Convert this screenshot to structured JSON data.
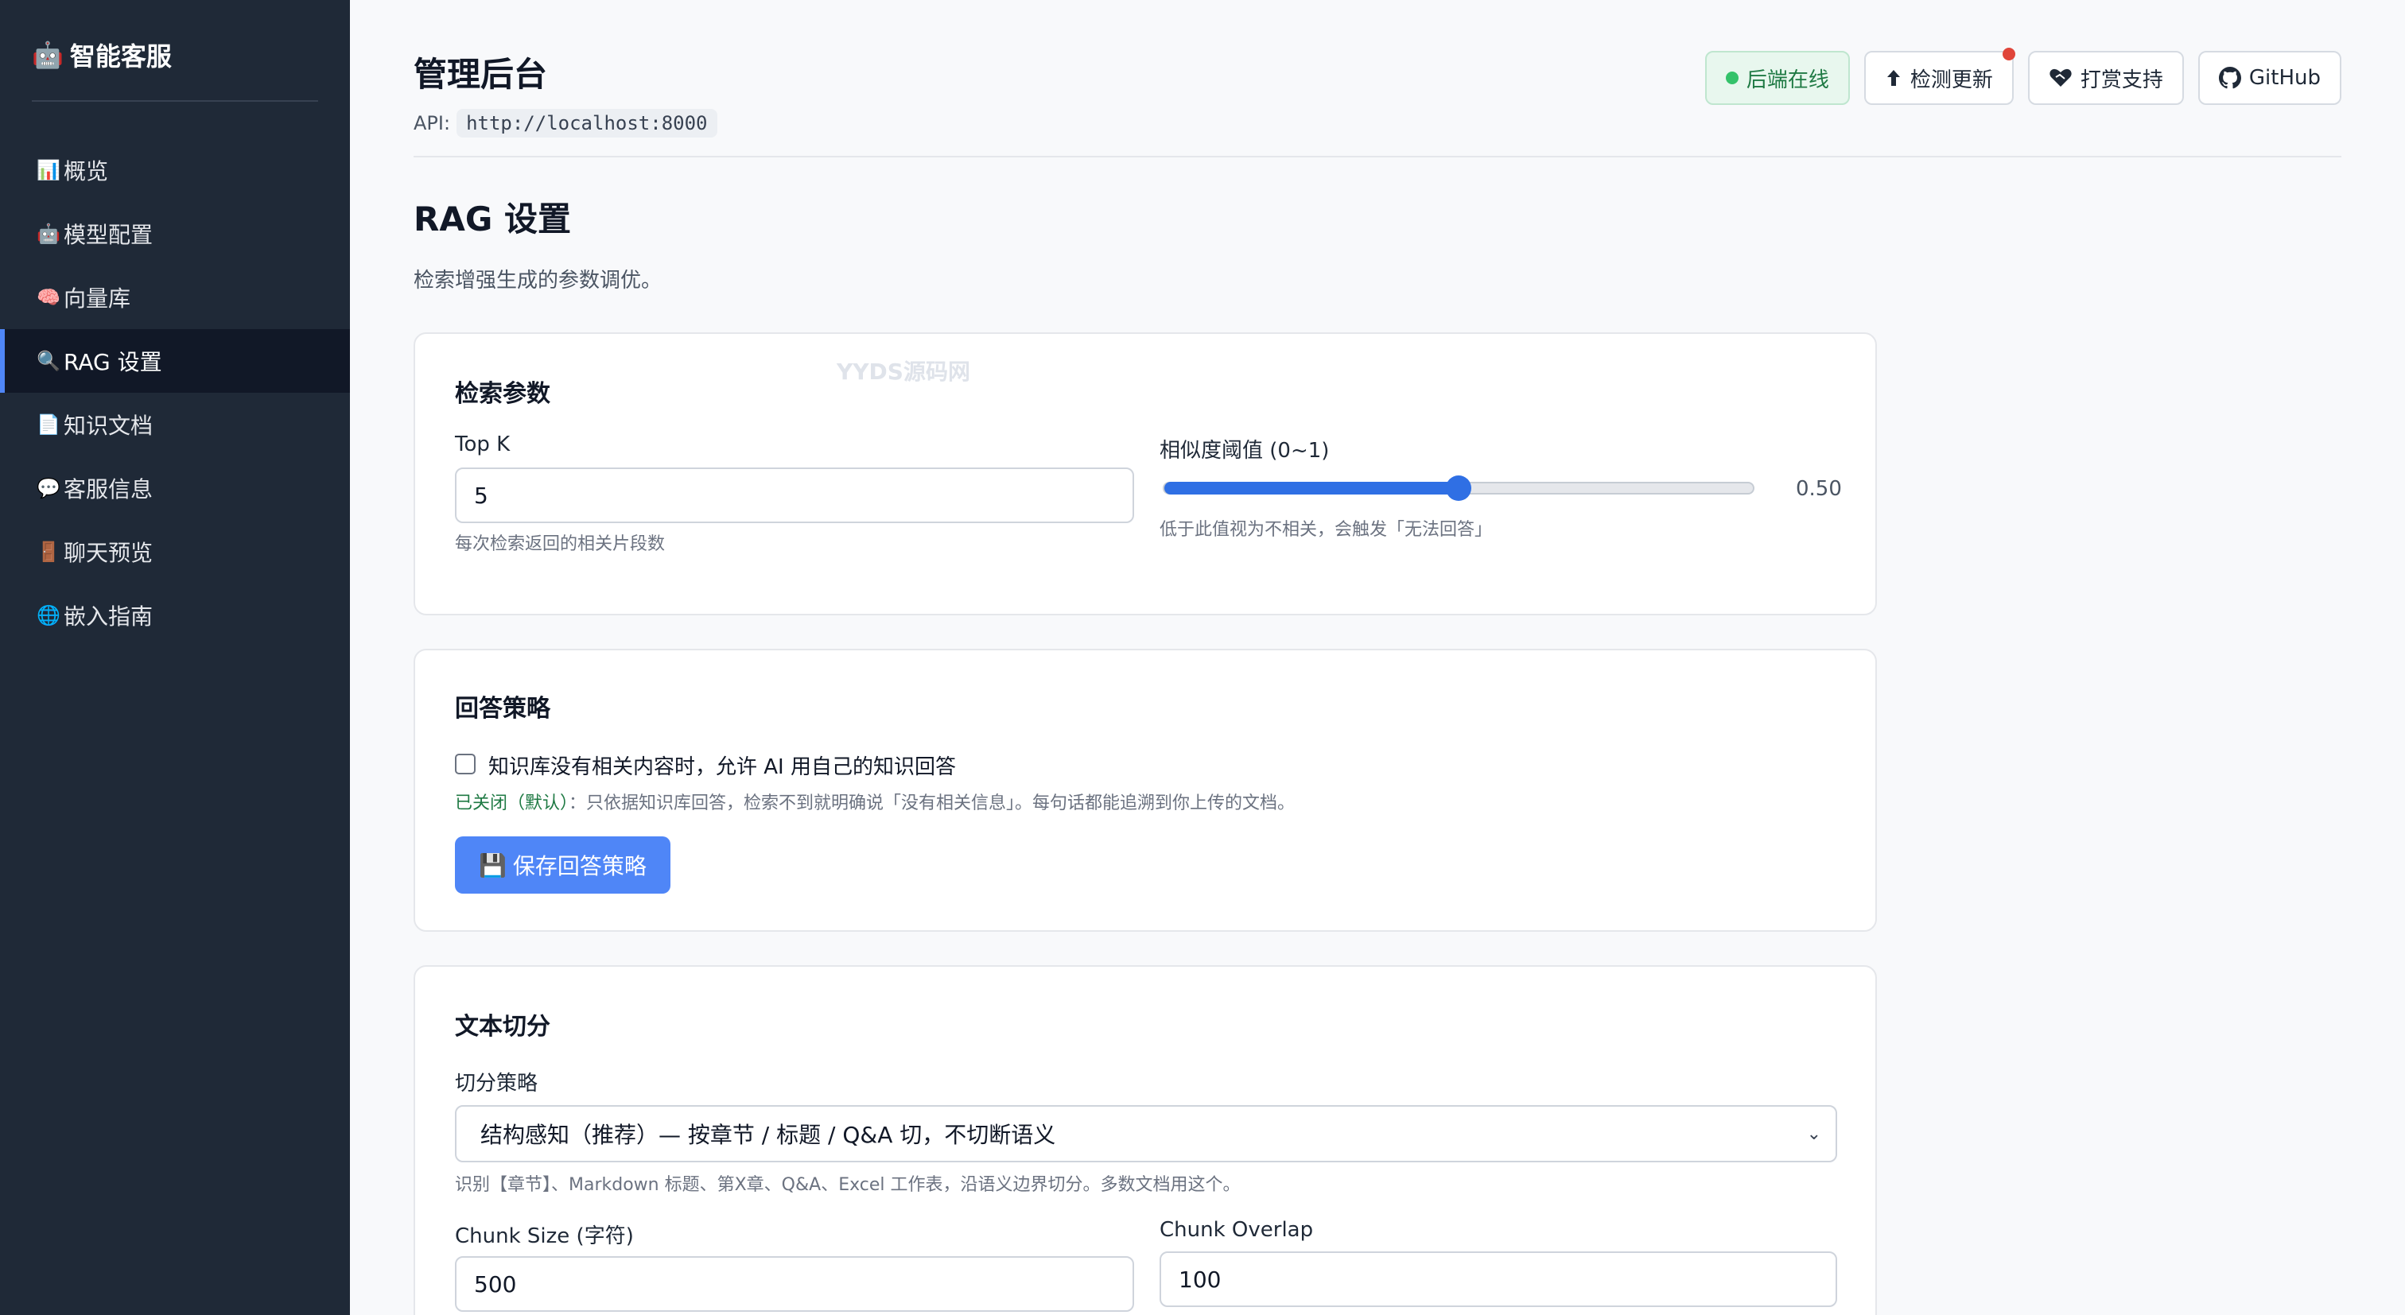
{
  "sidebar": {
    "brand_icon": "🤖",
    "brand": "智能客服",
    "items": [
      {
        "icon": "📊",
        "label": "概览"
      },
      {
        "icon": "🤖",
        "label": "模型配置"
      },
      {
        "icon": "🧠",
        "label": "向量库"
      },
      {
        "icon": "🔍",
        "label": "RAG 设置",
        "active": true
      },
      {
        "icon": "📄",
        "label": "知识文档"
      },
      {
        "icon": "💬",
        "label": "客服信息"
      },
      {
        "icon": "🚪",
        "label": "聊天预览"
      },
      {
        "icon": "🌐",
        "label": "嵌入指南"
      }
    ]
  },
  "header": {
    "title": "管理后台",
    "api_label": "API:",
    "api_url": "http://localhost:8000",
    "status": "后端在线",
    "check_update": "检测更新",
    "donate": "打赏支持",
    "github": "GitHub",
    "status_color": "#34c26a"
  },
  "section": {
    "title": "RAG 设置",
    "desc": "检索增强生成的参数调优。"
  },
  "watermark": "YYDS源码网",
  "retrieval": {
    "title": "检索参数",
    "topk_label": "Top K",
    "topk_value": "5",
    "topk_hint": "每次检索返回的相关片段数",
    "threshold_label": "相似度阈值 (0~1)",
    "threshold_value": 0.5,
    "threshold_text": "0.50",
    "threshold_hint": "低于此值视为不相关，会触发「无法回答」"
  },
  "answer": {
    "title": "回答策略",
    "checkbox_label": "知识库没有相关内容时，允许 AI 用自己的知识回答",
    "checked": false,
    "status_prefix": "已关闭（默认）",
    "status_text": "：只依据知识库回答，检索不到就明确说「没有相关信息」。每句话都能追溯到你上传的文档。",
    "save": "保存回答策略",
    "save_icon": "💾"
  },
  "chunking": {
    "title": "文本切分",
    "strategy_label": "切分策略",
    "strategy_value": "结构感知（推荐）— 按章节 / 标题 / Q&A 切，不切断语义",
    "strategy_hint": "识别【章节】、Markdown 标题、第X章、Q&A、Excel 工作表，沿语义边界切分。多数文档用这个。",
    "chunk_size_label": "Chunk Size (字符)",
    "chunk_size_value": "500",
    "overlap_label": "Chunk Overlap",
    "overlap_value": "100"
  }
}
